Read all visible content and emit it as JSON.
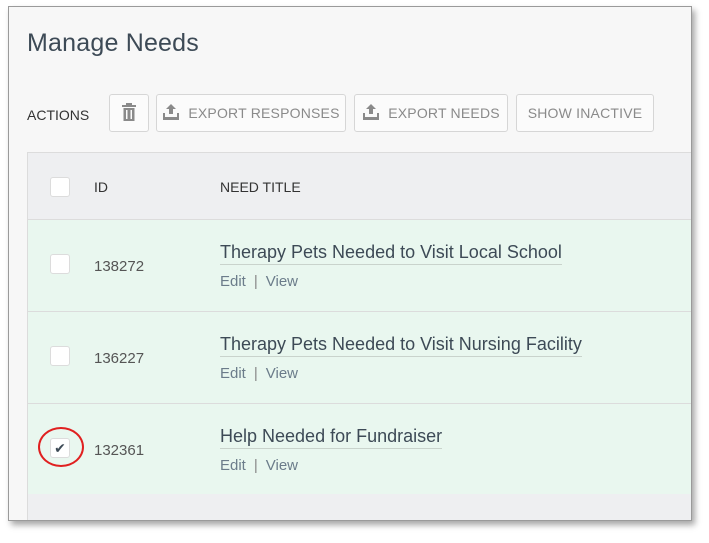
{
  "page": {
    "title": "Manage Needs"
  },
  "toolbar": {
    "actions_label": "ACTIONS",
    "trash_icon": "trash-icon",
    "export_responses_label": "EXPORT RESPONSES",
    "export_needs_label": "EXPORT NEEDS",
    "show_inactive_label": "SHOW INACTIVE",
    "upload_icon": "upload-icon"
  },
  "table": {
    "columns": {
      "id": "ID",
      "title": "NEED TITLE"
    },
    "rows": [
      {
        "id": "138272",
        "title": "Therapy Pets Needed to Visit Local School",
        "edit": "Edit",
        "sep": "|",
        "view": "View",
        "checked": false
      },
      {
        "id": "136227",
        "title": "Therapy Pets Needed to Visit Nursing Facility",
        "edit": "Edit",
        "sep": "|",
        "view": "View",
        "checked": false
      },
      {
        "id": "132361",
        "title": "Help Needed for Fundraiser",
        "edit": "Edit",
        "sep": "|",
        "view": "View",
        "checked": true
      }
    ]
  },
  "colors": {
    "row_bg": "#e9f7ef",
    "header_bg": "#eeeff1",
    "highlight": "#e02020"
  },
  "checkmark": "✔"
}
